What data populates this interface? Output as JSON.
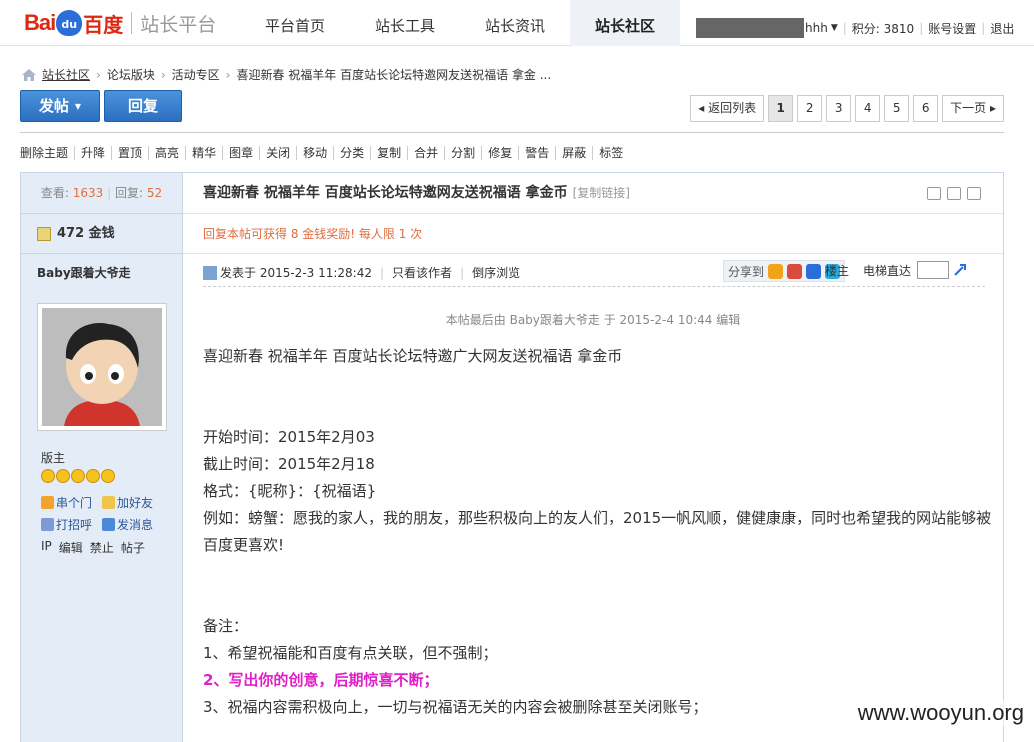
{
  "header": {
    "logo_bai": "Bai",
    "logo_du": "du",
    "logo_cn": "百度",
    "site_name": "站长平台",
    "nav": [
      "平台首页",
      "站长工具",
      "站长资讯",
      "站长社区"
    ],
    "user_suffix": "hhh",
    "score": "积分: 3810",
    "settings": "账号设置",
    "logout": "退出"
  },
  "breadcrumb": [
    "站长社区",
    "论坛版块",
    "活动专区",
    "喜迎新春 祝福羊年 百度站长论坛特邀网友送祝福语 拿金 ..."
  ],
  "actions": {
    "post": "发帖",
    "reply": "回复"
  },
  "pager": {
    "back": "返回列表",
    "pages": [
      "1",
      "2",
      "3",
      "4",
      "5",
      "6"
    ],
    "next": "下一页"
  },
  "modbar": [
    "删除主题",
    "升降",
    "置顶",
    "高亮",
    "精华",
    "图章",
    "关闭",
    "移动",
    "分类",
    "复制",
    "合并",
    "分割",
    "修复",
    "警告",
    "屏蔽",
    "标签"
  ],
  "sidebar": {
    "views_label": "查看:",
    "views": "1633",
    "replies_label": "回复:",
    "replies": "52",
    "gold": "472 金钱",
    "author": "Baby跟着大爷走",
    "role": "版主",
    "links": [
      "串个门",
      "加好友",
      "打招呼",
      "发消息"
    ],
    "admin": [
      "IP",
      "编辑",
      "禁止",
      "帖子"
    ]
  },
  "post": {
    "title": "喜迎新春 祝福羊年 百度站长论坛特邀网友送祝福语 拿金币",
    "copy_link": "[复制链接]",
    "reward": "回复本帖可获得 8 金钱奖励! 每人限 1 次",
    "posted": "发表于 2015-2-3 11:28:42",
    "only_author": "只看该作者",
    "reverse": "倒序浏览",
    "share_label": "分享到",
    "floor": "楼主",
    "elevator": "电梯直达",
    "edited_note": "本帖最后由 Baby跟着大爷走 于 2015-2-4 10:44 编辑",
    "body": {
      "intro": "喜迎新春 祝福羊年 百度站长论坛特邀广大网友送祝福语 拿金币",
      "start": "开始时间：2015年2月03",
      "end": "截止时间：2015年2月18",
      "format": "格式：{昵称}：{祝福语}",
      "example": "例如：螃蟹：愿我的家人，我的朋友，那些积极向上的友人们，2015一帆风顺，健健康康，同时也希望我的网站能够被百度更喜欢!",
      "note_title": "备注：",
      "note1": "1、希望祝福能和百度有点关联，但不强制；",
      "note2": "2、写出你的创意，后期惊喜不断；",
      "note3": "3、祝福内容需积极向上，一切与祝福语无关的内容会被删除甚至关闭账号；"
    }
  },
  "watermark": "www.wooyun.org",
  "colors": {
    "accent": "#2c6fc0",
    "logo_red": "#de2910",
    "reward": "#e06c3d",
    "highlight": "#e11fc8"
  }
}
